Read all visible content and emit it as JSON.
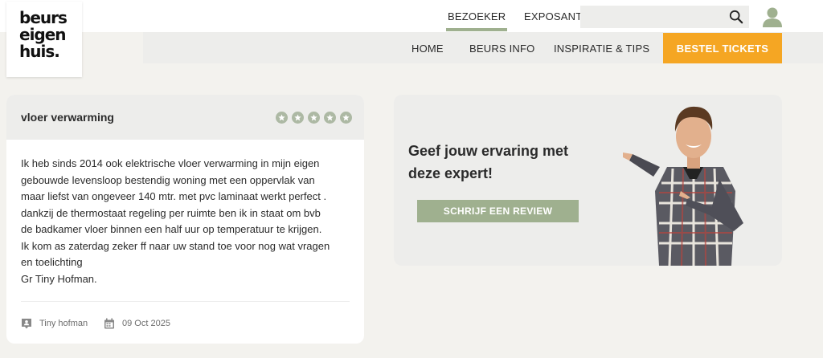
{
  "logo": {
    "lines": [
      "beurs",
      "eigen",
      "huis."
    ]
  },
  "audience_tabs": [
    {
      "label": "BEZOEKER",
      "active": true
    },
    {
      "label": "EXPOSANT",
      "active": false
    }
  ],
  "search": {
    "placeholder": "",
    "icon": "search-icon"
  },
  "account": {
    "icon": "user-icon"
  },
  "nav": {
    "items": [
      "HOME",
      "BEURS INFO",
      "INSPIRATIE & TIPS"
    ],
    "cta_label": "BESTEL TICKETS"
  },
  "review": {
    "title": "vloer verwarming",
    "stars": 5,
    "text": "Ik heb sinds 2014 ook elektrische vloer verwarming in mijn eigen\ngebouwde levensloop bestendig woning met een oppervlak van\nmaar liefst van ongeveer 140 mtr. met pvc laminaat werkt perfect .\ndankzij de thermostaat regeling per ruimte ben ik in staat om bvb\nde badkamer vloer binnen een half uur op temperatuur te krijgen.\nIk kom as zaterdag zeker ff naar uw stand toe voor nog wat vragen\nen toelichting\nGr Tiny Hofman.",
    "author": "Tiny hofman",
    "date": "09 Oct 2025"
  },
  "promo": {
    "title": "Geef jouw ervaring met deze expert!",
    "button_label": "SCHRIJF EEN REVIEW"
  },
  "colors": {
    "accent_green": "#9fb08f",
    "cta_orange": "#f5a623",
    "panel_grey": "#ededeb",
    "page_bg": "#f3f2ee"
  }
}
